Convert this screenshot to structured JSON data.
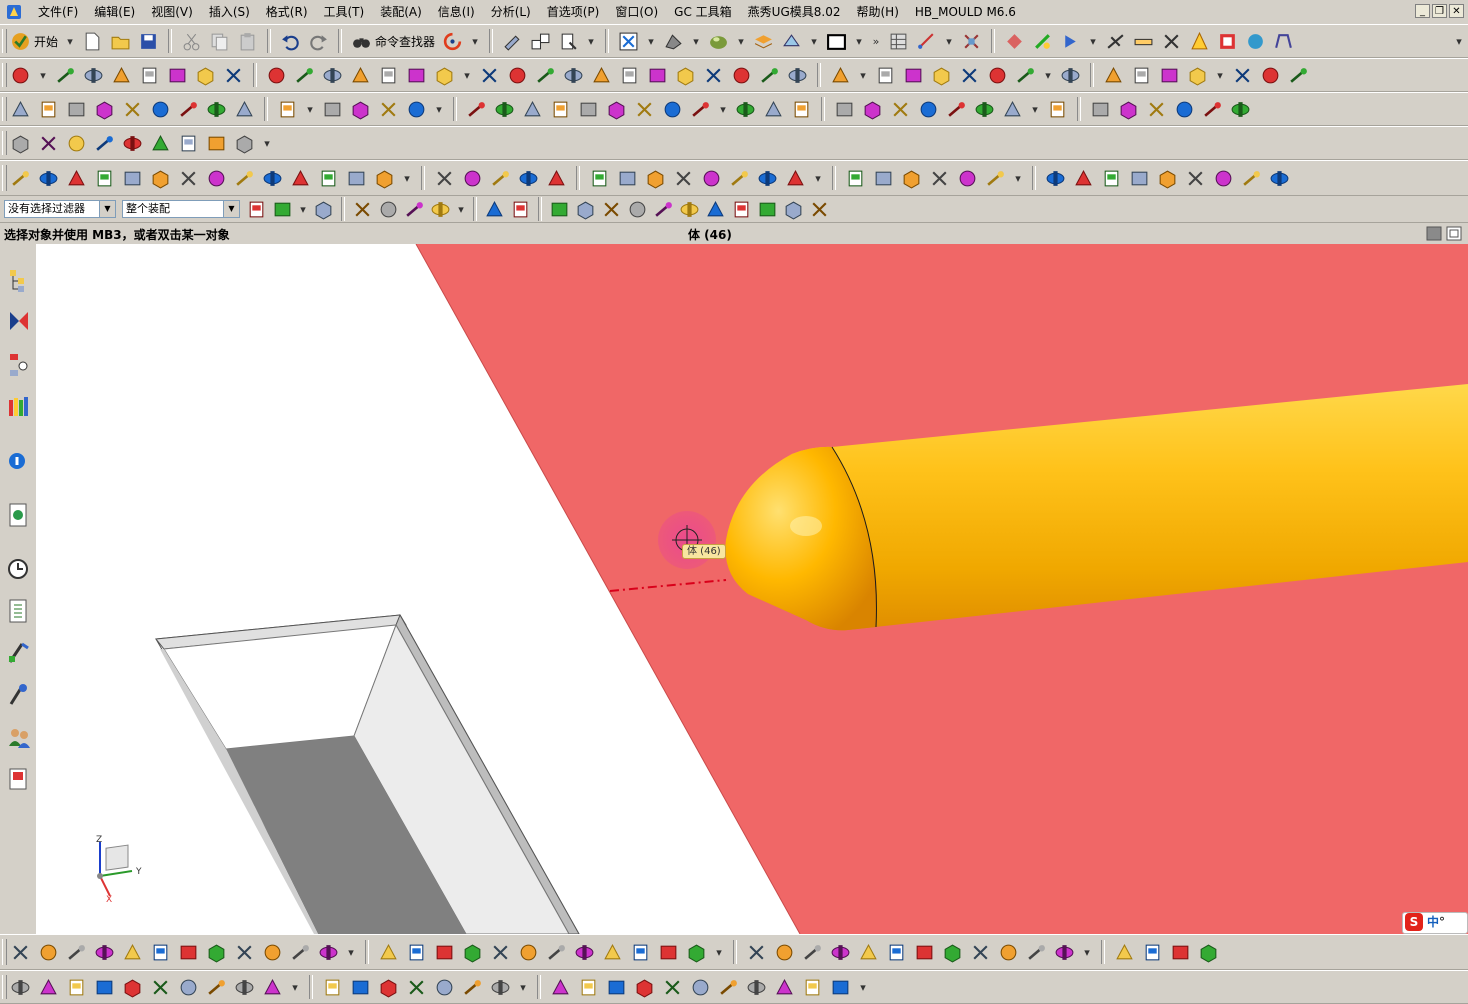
{
  "menubar": {
    "items": [
      "文件(F)",
      "编辑(E)",
      "视图(V)",
      "插入(S)",
      "格式(R)",
      "工具(T)",
      "装配(A)",
      "信息(I)",
      "分析(L)",
      "首选项(P)",
      "窗口(O)",
      "GC 工具箱",
      "燕秀UG模具8.02",
      "帮助(H)",
      "HB_MOULD M6.6"
    ],
    "window_buttons": [
      "_",
      "❐",
      "✕"
    ]
  },
  "toolbar_standard": {
    "start_label": "开始",
    "command_finder_label": "命令查找器"
  },
  "selection_bar": {
    "filter_value": "没有选择过滤器",
    "scope_value": "整个装配"
  },
  "statusbar": {
    "prompt": "选择对象并使用 MB3，或者双击某一对象",
    "status": "体 (46)"
  },
  "viewport": {
    "tooltip": "体 (46)",
    "triad": {
      "z": "Z",
      "y": "Y",
      "x": "X"
    },
    "colors": {
      "background": "#ffffff",
      "plate_red": "#f06767",
      "pin_yellow": "#f5b400",
      "pocket_dark": "#808080",
      "preselect_highlight": "#e8409a"
    }
  },
  "ime": {
    "logo": "S",
    "lang": "中",
    "dot": "°"
  },
  "icons": [
    "app-icon",
    "new-file-icon",
    "open-file-icon",
    "save-icon",
    "cut-icon",
    "copy-icon",
    "paste-icon",
    "undo-icon",
    "redo-icon",
    "binoculars-icon",
    "refresh-icon",
    "fit-view-icon",
    "zoom-icon",
    "pan-icon",
    "rotate-icon",
    "shaded-view-icon",
    "block-icon",
    "cylinder-icon",
    "sphere-icon",
    "extrude-icon",
    "line-icon",
    "arc-icon",
    "rectangle-icon",
    "text-icon",
    "point-icon",
    "mirror-icon",
    "hole-icon",
    "layer-icon",
    "wcs-icon",
    "grid-icon",
    "assembly-navigator-icon",
    "part-navigator-icon",
    "history-icon",
    "palette-icon",
    "roles-icon",
    "system-materials-icon",
    "stop-icon",
    "cube-icon",
    "move-icon"
  ]
}
